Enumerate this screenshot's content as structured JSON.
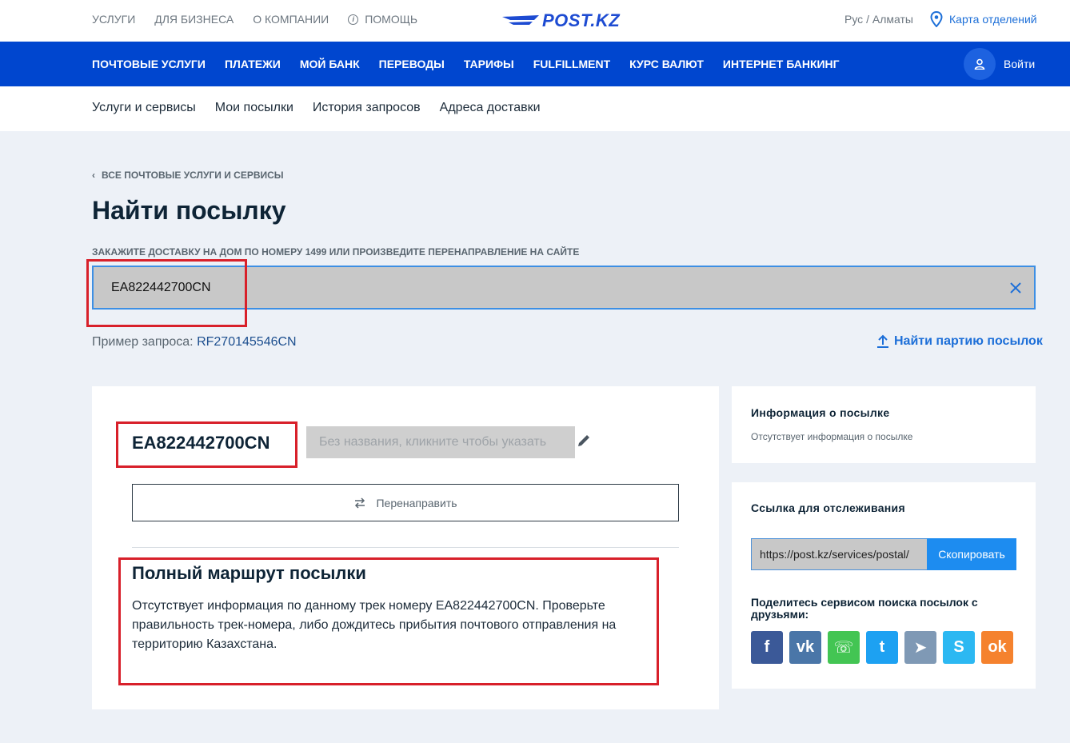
{
  "top": {
    "nav": [
      "УСЛУГИ",
      "ДЛЯ БИЗНЕСА",
      "О КОМПАНИИ",
      "ПОМОЩЬ"
    ],
    "logo": "POST.KZ",
    "region": "Рус / Алматы",
    "branches": "Карта отделений"
  },
  "main_nav": [
    "ПОЧТОВЫЕ УСЛУГИ",
    "ПЛАТЕЖИ",
    "МОЙ БАНК",
    "ПЕРЕВОДЫ",
    "ТАРИФЫ",
    "FULFILLMENT",
    "КУРС ВАЛЮТ",
    "ИНТЕРНЕТ БАНКИНГ"
  ],
  "login": "Войти",
  "sub_nav": [
    "Услуги и сервисы",
    "Мои посылки",
    "История запросов",
    "Адреса доставки"
  ],
  "breadcrumb": "ВСЕ ПОЧТОВЫЕ УСЛУГИ И СЕРВИСЫ",
  "page_title": "Найти посылку",
  "hint": "ЗАКАЖИТЕ ДОСТАВКУ НА ДОМ ПО НОМЕРУ 1499 ИЛИ ПРОИЗВЕДИТЕ ПЕРЕНАПРАВЛЕНИЕ НА САЙТЕ",
  "search": {
    "value": "EA822442700CN"
  },
  "example": {
    "label": "Пример запроса:",
    "value": "RF270145546CN"
  },
  "batch_link": "Найти партию посылок",
  "parcel": {
    "track": "EA822442700CN",
    "name_placeholder": "Без названия, кликните чтобы указать",
    "redirect": "Перенаправить",
    "route_title": "Полный маршрут посылки",
    "route_text": "Отсутствует информация по данному трек номеру EA822442700CN. Проверьте правильность трек-номера, либо дождитесь прибытия почтового отправления на территорию Казахстана."
  },
  "info": {
    "title": "Информация о посылке",
    "text": "Отсутствует информация о посылке"
  },
  "tracking_link": {
    "title": "Ссылка для отслеживания",
    "url": "https://post.kz/services/postal/",
    "copy": "Скопировать",
    "share_title": "Поделитесь сервисом поиска посылок с друзьями:"
  },
  "socials": [
    {
      "name": "facebook",
      "glyph": "f",
      "color": "#3b5998"
    },
    {
      "name": "vk",
      "glyph": "vk",
      "color": "#4a76a8"
    },
    {
      "name": "whatsapp",
      "glyph": "☏",
      "color": "#43c553"
    },
    {
      "name": "twitter",
      "glyph": "t",
      "color": "#1da1f2"
    },
    {
      "name": "telegram",
      "glyph": "➤",
      "color": "#7f99b5"
    },
    {
      "name": "skype",
      "glyph": "S",
      "color": "#2cb8f2"
    },
    {
      "name": "odnoklassniki",
      "glyph": "ok",
      "color": "#f5822e"
    }
  ]
}
